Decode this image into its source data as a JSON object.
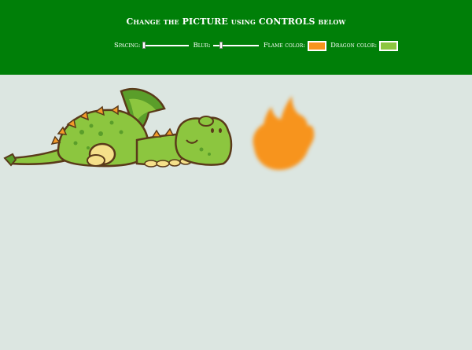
{
  "header": {
    "title": "Change the PICTURE using CONTROLS below"
  },
  "controls": {
    "spacing": {
      "label": "Spacing:",
      "value": 0.03
    },
    "blur": {
      "label": "Blur:",
      "value": 0.18
    },
    "flame_color": {
      "label": "Flame color:",
      "value": "#f7941d"
    },
    "dragon_color": {
      "label": "Dragon color:",
      "value": "#8cc63f"
    }
  },
  "colors": {
    "header_bg": "#007f08",
    "page_bg": "#dce6e1",
    "outline": "#5a3a1a",
    "dragon_dark": "#5a9e2a",
    "belly": "#f5e08a",
    "spikes": "#f29a2a"
  },
  "icons": {
    "dragon": "sleeping-dragon-illustration",
    "flame": "flame-illustration"
  }
}
